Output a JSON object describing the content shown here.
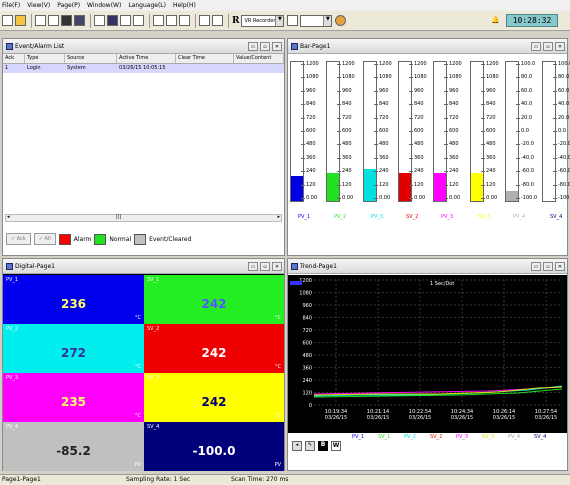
{
  "menu": [
    "File(F)",
    "View(V)",
    "Page(P)",
    "Window(W)",
    "Language(L)",
    "Help(H)"
  ],
  "toolbar": {
    "recorder_combo": "VR Recorder",
    "combo2": ""
  },
  "clock": "10:28:32",
  "event_window": {
    "title": "Event/Alarm List",
    "columns": [
      "Ack",
      "Type",
      "Source",
      "Active Time",
      "Clear Time",
      "Value/Content"
    ],
    "rows": [
      {
        "ack": "1",
        "type": "Login",
        "source": "System",
        "active": "03/26/15 10:05:15",
        "clear": "",
        "value": ""
      }
    ],
    "ack_btn": "Ack",
    "all_btn": "All",
    "legend": [
      {
        "label": "Alarm",
        "color": "#ff0000"
      },
      {
        "label": "Normal",
        "color": "#22e022"
      },
      {
        "label": "Event/Cleared",
        "color": "#c0c0c0"
      }
    ]
  },
  "bar_window": {
    "title": "Bar-Page1",
    "bars": [
      {
        "label": "PV_1",
        "color": "#0000e0",
        "fill": 0.18,
        "ticks": [
          "1200",
          "1080",
          "960",
          "840",
          "720",
          "600",
          "480",
          "360",
          "240",
          "120",
          "0.00"
        ]
      },
      {
        "label": "PV_2",
        "color": "#22e022",
        "fill": 0.2,
        "ticks": [
          "1200",
          "1080",
          "960",
          "840",
          "720",
          "600",
          "480",
          "360",
          "240",
          "120",
          "0.00"
        ]
      },
      {
        "label": "PV_3",
        "color": "#00e0e0",
        "fill": 0.23,
        "ticks": [
          "1200",
          "1080",
          "960",
          "840",
          "720",
          "600",
          "480",
          "360",
          "240",
          "120",
          "0.00"
        ]
      },
      {
        "label": "SV_2",
        "color": "#e00000",
        "fill": 0.2,
        "ticks": [
          "1200",
          "1080",
          "960",
          "840",
          "720",
          "600",
          "480",
          "360",
          "240",
          "120",
          "0.00"
        ]
      },
      {
        "label": "PV_3",
        "color": "#ff00ff",
        "fill": 0.2,
        "ticks": [
          "1200",
          "1080",
          "960",
          "840",
          "720",
          "600",
          "480",
          "360",
          "240",
          "120",
          "0.00"
        ]
      },
      {
        "label": "SV_3",
        "color": "#ffff00",
        "fill": 0.2,
        "ticks": [
          "1200",
          "1080",
          "960",
          "840",
          "720",
          "600",
          "480",
          "360",
          "240",
          "120",
          "0.00"
        ]
      },
      {
        "label": "PV_4",
        "color": "#b0b0b0",
        "fill": 0.07,
        "ticks": [
          "100.0",
          "80.0",
          "60.0",
          "40.0",
          "20.0",
          "0.0",
          "-20.0",
          "-40.0",
          "-60.0",
          "-80.0",
          "-100.0"
        ]
      },
      {
        "label": "SV_4",
        "color": "#00007a",
        "fill": 0.0,
        "ticks": [
          "100.0",
          "80.0",
          "60.0",
          "40.0",
          "20.0",
          "0.0",
          "-20.0",
          "-40.0",
          "-60.0",
          "-80.0",
          "-100.0"
        ]
      }
    ]
  },
  "digital_window": {
    "title": "Digital-Page1",
    "cells": [
      {
        "label": "PV_1",
        "value": "236",
        "unit": "°C",
        "bg": "#0000ee",
        "fg": "#ffff66"
      },
      {
        "label": "SV_1",
        "value": "242",
        "unit": "°C",
        "bg": "#22ee22",
        "fg": "#5555ff"
      },
      {
        "label": "PV_2",
        "value": "272",
        "unit": "°C",
        "bg": "#00eeee",
        "fg": "#333399"
      },
      {
        "label": "SV_2",
        "value": "242",
        "unit": "°C",
        "bg": "#ee0000",
        "fg": "#ffffff"
      },
      {
        "label": "PV_3",
        "value": "235",
        "unit": "°C",
        "bg": "#ff00ff",
        "fg": "#ffff66"
      },
      {
        "label": "SV_3",
        "value": "242",
        "unit": "°C",
        "bg": "#ffff00",
        "fg": "#000066"
      },
      {
        "label": "PV_4",
        "value": "-85.2",
        "unit": "PV",
        "bg": "#c0c0c0",
        "fg": "#222222"
      },
      {
        "label": "SV_4",
        "value": "-100.0",
        "unit": "PV",
        "bg": "#00007a",
        "fg": "#ffffff"
      }
    ]
  },
  "trend_window": {
    "title": "Trend-Page1",
    "interval": "1 Sec/Dot",
    "y_ticks": [
      "1200",
      "1080",
      "960",
      "840",
      "720",
      "600",
      "480",
      "360",
      "240",
      "120",
      "0"
    ],
    "x_ticks": [
      {
        "time": "10:19:34",
        "date": "03/26/15"
      },
      {
        "time": "10:21:14",
        "date": "03/26/15"
      },
      {
        "time": "10:22:54",
        "date": "03/26/15"
      },
      {
        "time": "10:24:34",
        "date": "03/26/15"
      },
      {
        "time": "10:26:14",
        "date": "03/26/15"
      },
      {
        "time": "10:27:54",
        "date": "03/26/15"
      }
    ],
    "legend": [
      {
        "label": "PV_1",
        "color": "#0000ff"
      },
      {
        "label": "SV_1",
        "color": "#22e022"
      },
      {
        "label": "PV_2",
        "color": "#00e0e0"
      },
      {
        "label": "SV_2",
        "color": "#ff0000"
      },
      {
        "label": "PV_3",
        "color": "#ff00ff"
      },
      {
        "label": "SV_3",
        "color": "#e0e000"
      },
      {
        "label": "PV_4",
        "color": "#a0a0a0"
      },
      {
        "label": "SV_4",
        "color": "#000080"
      }
    ],
    "btn_b": "B",
    "btn_w": "W"
  },
  "status": {
    "page": "Page1-Page1",
    "sampling": "Sampling Rate: 1 Sec",
    "scan": "Scan Time: 270 ms"
  }
}
